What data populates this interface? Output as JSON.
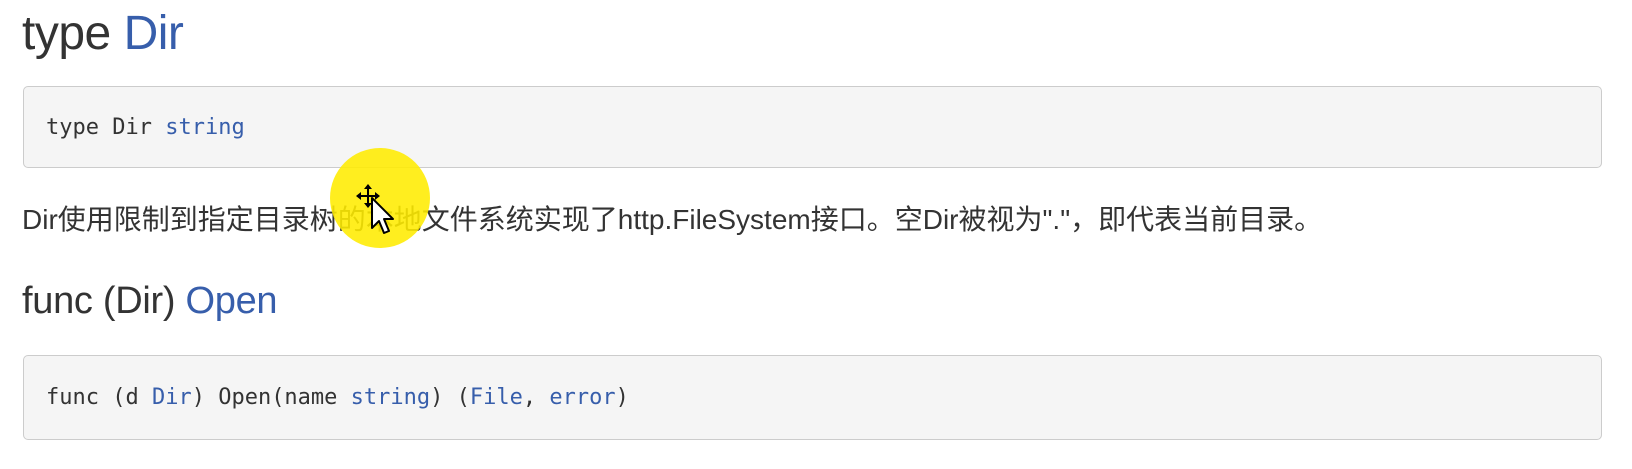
{
  "type_section": {
    "heading_prefix": "type ",
    "heading_link": "Dir",
    "code": {
      "plain": "type Dir ",
      "keyword": "string"
    },
    "description": "Dir使用限制到指定目录树的本地文件系统实现了http.FileSystem接口。空Dir被视为\".\"，即代表当前目录。"
  },
  "method_section": {
    "heading_prefix": "func (Dir) ",
    "heading_link": "Open",
    "code": {
      "p1": "func (d ",
      "t1": "Dir",
      "p2": ") Open(name ",
      "t2": "string",
      "p3": ") (",
      "t3": "File",
      "p4": ", ",
      "t4": "error",
      "p5": ")"
    }
  },
  "colors": {
    "link": "#375eab",
    "text": "#333333",
    "code_bg": "#f5f5f5",
    "cursor_highlight": "#ffec00"
  },
  "icons": {
    "cursor": "move-cursor-icon"
  }
}
